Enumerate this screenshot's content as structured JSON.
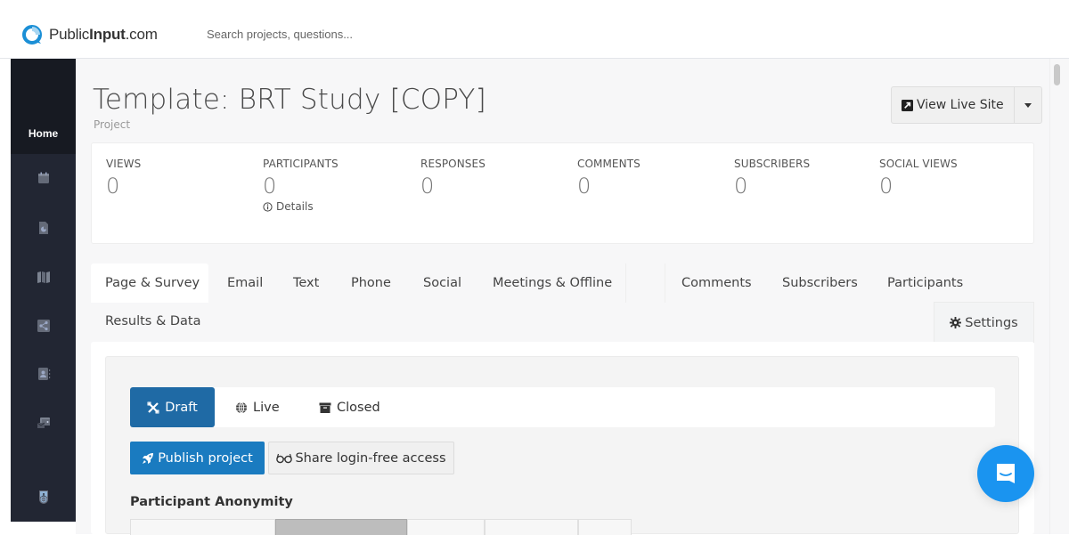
{
  "topbar": {
    "brand_prefix": "Public",
    "brand_bold": "Input",
    "brand_suffix": ".com",
    "search_placeholder": "Search projects, questions..."
  },
  "sidebar": {
    "home_label": "Home",
    "items": [
      {
        "icon": "calendar-icon"
      },
      {
        "icon": "report-icon"
      },
      {
        "icon": "map-icon"
      },
      {
        "icon": "share-icon"
      },
      {
        "icon": "contacts-icon"
      },
      {
        "icon": "mail-campaign-icon"
      },
      {
        "icon": "organization-badge-icon"
      }
    ]
  },
  "header": {
    "title": "Template: BRT Study [COPY]",
    "subtitle": "Project",
    "view_live_label": "View Live Site"
  },
  "stats": [
    {
      "label": "VIEWS",
      "value": "0"
    },
    {
      "label": "PARTICIPANTS",
      "value": "0",
      "details": "Details"
    },
    {
      "label": "RESPONSES",
      "value": "0"
    },
    {
      "label": "COMMENTS",
      "value": "0"
    },
    {
      "label": "SUBSCRIBERS",
      "value": "0"
    },
    {
      "label": "SOCIAL VIEWS",
      "value": "0"
    }
  ],
  "tabs": {
    "row1_left": [
      "Page & Survey",
      "Email",
      "Text",
      "Phone",
      "Social",
      "Meetings & Offline"
    ],
    "row1_right": [
      "Comments",
      "Subscribers",
      "Participants"
    ],
    "row2": [
      "Results & Data"
    ],
    "settings": "Settings",
    "active": "Page & Survey"
  },
  "status": {
    "options": [
      "Draft",
      "Live",
      "Closed"
    ],
    "selected": "Draft"
  },
  "actions": {
    "publish": "Publish project",
    "share": "Share login-free access"
  },
  "anonymity": {
    "title": "Participant Anonymity"
  },
  "colors": {
    "primary": "#1a7bc0",
    "draft_active": "#1f6aa5",
    "sidebar_bg": "#222633",
    "chat": "#1a94f0"
  }
}
